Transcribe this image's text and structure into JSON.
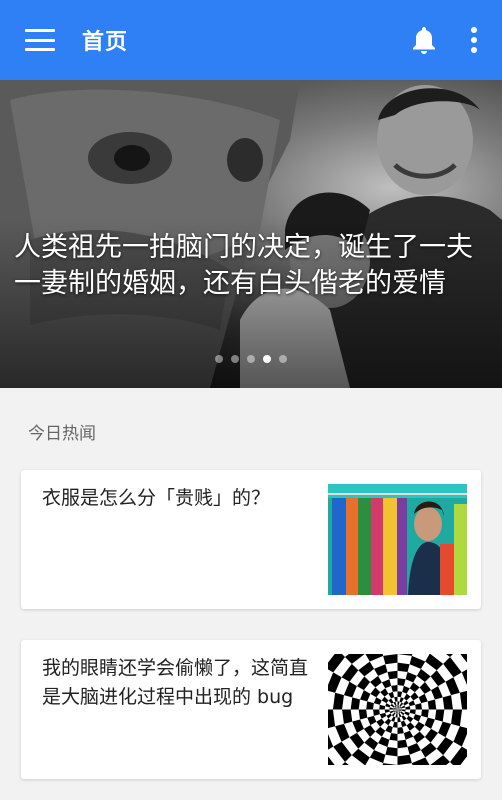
{
  "app_bar": {
    "title": "首页",
    "icons": {
      "menu": "hamburger-menu-icon",
      "notifications": "bell-icon",
      "overflow": "more-vert-icon"
    },
    "color": "#2f80f5"
  },
  "hero": {
    "caption": "人类祖先一拍脑门的决定，诞生了一夫一妻制的婚姻，还有白头偕老的爱情",
    "page_count": 5,
    "active_index": 3
  },
  "section": {
    "title": "今日热闻"
  },
  "stories": [
    {
      "title": "衣服是怎么分「贵贱」的？",
      "image": "clothing-rack-thumbnail"
    },
    {
      "title": "我的眼睛还学会偷懒了，这简直是大脑进化过程中出现的 bug",
      "image": "optical-illusion-checker-thumbnail"
    }
  ]
}
